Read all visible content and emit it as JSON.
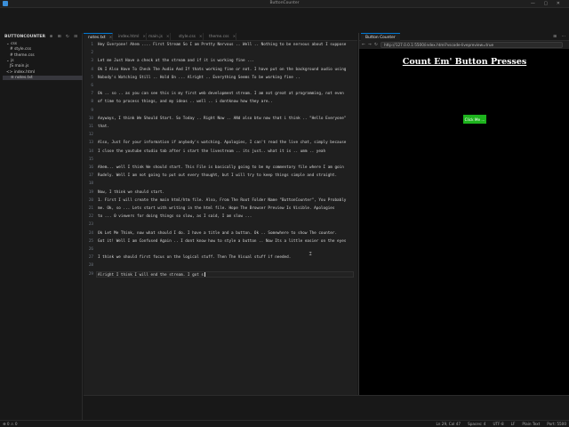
{
  "window": {
    "title": "ButtonCounter",
    "controls": "— ▢ ✕"
  },
  "sidebar": {
    "header": "BUTTONCOUNTER",
    "actions": "⊕ ⊞ ↻ ⊟",
    "items": [
      {
        "label": "⌄ css",
        "indent": 1
      },
      {
        "label": "# style.css",
        "indent": 2
      },
      {
        "label": "# theme.css",
        "indent": 2
      },
      {
        "label": "⌄ js",
        "indent": 1
      },
      {
        "label": "JS main.js",
        "indent": 2
      },
      {
        "label": "<> index.html",
        "indent": 1
      },
      {
        "label": "≡ notes.txt",
        "indent": 1,
        "selected": true
      }
    ]
  },
  "tabs": [
    {
      "label": "notes.txt",
      "active": true
    },
    {
      "label": "index.html"
    },
    {
      "label": "main.js"
    },
    {
      "label": "style.css"
    },
    {
      "label": "theme.css"
    }
  ],
  "tab_close": "×",
  "editor": {
    "lines": [
      {
        "num": "1",
        "text": "Hey Everyone! Ahem .... First Stream So I am Pretty Nervous .. Well .. Nothing to be nervous about I suppose"
      },
      {
        "num": "2",
        "text": ""
      },
      {
        "num": "3",
        "text": "Let me Just Have a check at the stream and if it is working fine ..."
      },
      {
        "num": "4",
        "text": "Ok I Also Have To Check The Audio And If thats working fine or not. I have put on the background audio using"
      },
      {
        "num": "5",
        "text": "Nobody's Watching Still .. Hold On ... Alright .. Everything Seems To be working fine .."
      },
      {
        "num": "6",
        "text": ""
      },
      {
        "num": "7",
        "text": "Ok .. so .. as you can see this is my first web development stream. I am not great at programming, not even"
      },
      {
        "num": "8",
        "text": "of time to process things, and my ideas .. well .. i dontknow how they are.."
      },
      {
        "num": "9",
        "text": ""
      },
      {
        "num": "10",
        "text": "Anyways, I think We Should Start. So Today .. Right Now .. ANd also btw now that i think .. \"Hello Everyone\""
      },
      {
        "num": "11",
        "text": "that."
      },
      {
        "num": "12",
        "text": ""
      },
      {
        "num": "13",
        "text": "Also, Just For your information if anybody's watching. Apologies, I can't read the live chat, simply because"
      },
      {
        "num": "14",
        "text": "I close the youtube studio tab after i start the livestream .. its just.. what it is .. umm .. yeah"
      },
      {
        "num": "15",
        "text": ""
      },
      {
        "num": "16",
        "text": "Ahem... well I think We should start. This File is basically going to be my commentary file where I am goin"
      },
      {
        "num": "17",
        "text": "Rudely. Well I am not going to put out every thought, but I will try to keep things simple and straight."
      },
      {
        "num": "18",
        "text": ""
      },
      {
        "num": "19",
        "text": "Now, I think we should start."
      },
      {
        "num": "20",
        "text": "1. First I will create the main html/htm file. Also, From The Root Folder Name \"ButtonCounter\", You Probably"
      },
      {
        "num": "21",
        "text": "me. Ok, so ... Lets start with writing in the html file. Hope The Browser Preview Is Visible. Apologies"
      },
      {
        "num": "22",
        "text": "to ... 0 viewers for doing things so slow, as I said, I am slow ..."
      },
      {
        "num": "23",
        "text": ""
      },
      {
        "num": "24",
        "text": "Ok Let Me Think, now what should I do. I have a title and a button. Ok .. Somewhere to show The counter."
      },
      {
        "num": "25",
        "text": "Got it! Well I am Confused Again .. I dont know how to style a button .. Now Its a little easier on the eyes"
      },
      {
        "num": "26",
        "text": ""
      },
      {
        "num": "27",
        "text": "I think we should first focus on the logical stuff. Then The Visual stuff if needed."
      },
      {
        "num": "28",
        "text": ""
      },
      {
        "num": "29",
        "text": "Alright I think I will end the stream. I got s",
        "current": true
      }
    ]
  },
  "preview": {
    "tab_label": "Button Counter",
    "tab_actions": "⊞ ⋯",
    "nav": {
      "back": "←",
      "forward": "→",
      "reload": "↻"
    },
    "url": "http://127.0.0.1:5500/index.html?vscode-livepreview=true",
    "heading": "Count Em' Button Presses",
    "button_label": "Click Me ..."
  },
  "statusbar": {
    "left": "⊗ 0 ⚠ 0",
    "items": [
      "Ln 29, Col 47",
      "Spaces: 4",
      "UTF-8",
      "LF",
      "Plain Text",
      "Port: 5500"
    ]
  }
}
